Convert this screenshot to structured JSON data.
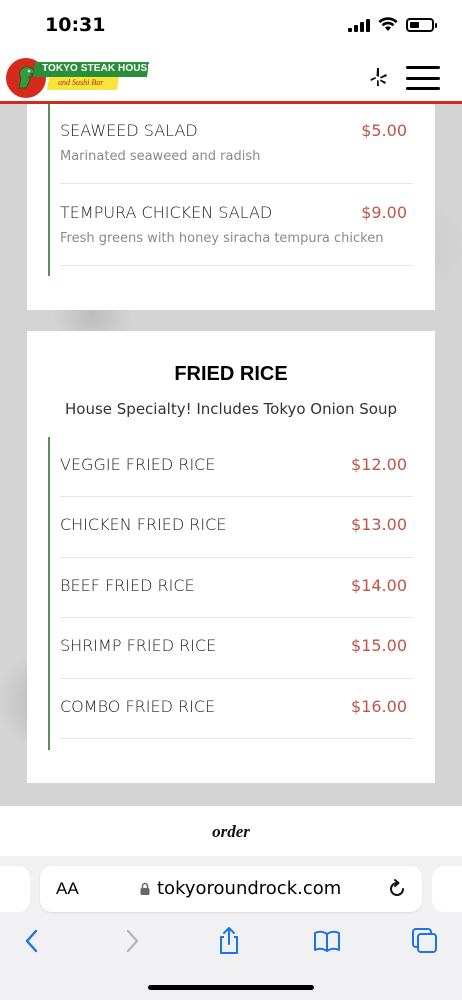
{
  "status_bar": {
    "time": "10:31"
  },
  "header": {
    "logo_title": "TOKYO STEAK HOUSE",
    "logo_subtitle": "and Sushi Bar",
    "yelp_icon": "yelp-icon",
    "menu_icon": "hamburger-menu-icon"
  },
  "salads": {
    "items": [
      {
        "name": "SEAWEED SALAD",
        "price": "$5.00",
        "description": "Marinated seaweed and radish"
      },
      {
        "name": "TEMPURA CHICKEN SALAD",
        "price": "$9.00",
        "description": "Fresh greens with honey siracha tempura chicken"
      }
    ]
  },
  "fried_rice": {
    "title": "FRIED RICE",
    "subtitle": "House Specialty! Includes Tokyo Onion Soup",
    "items": [
      {
        "name": "VEGGIE FRIED RICE",
        "price": "$12.00"
      },
      {
        "name": "CHICKEN FRIED RICE",
        "price": "$13.00"
      },
      {
        "name": "BEEF FRIED RICE",
        "price": "$14.00"
      },
      {
        "name": "SHRIMP FRIED RICE",
        "price": "$15.00"
      },
      {
        "name": "COMBO FRIED RICE",
        "price": "$16.00"
      }
    ]
  },
  "order": {
    "label": "order"
  },
  "browser": {
    "text_size_label": "AA",
    "url": "tokyoroundrock.com"
  },
  "colors": {
    "accent_red": "#d12a1f",
    "price_red": "#c0554a",
    "menu_green": "#5b8f55",
    "ios_blue": "#1a73e8"
  }
}
